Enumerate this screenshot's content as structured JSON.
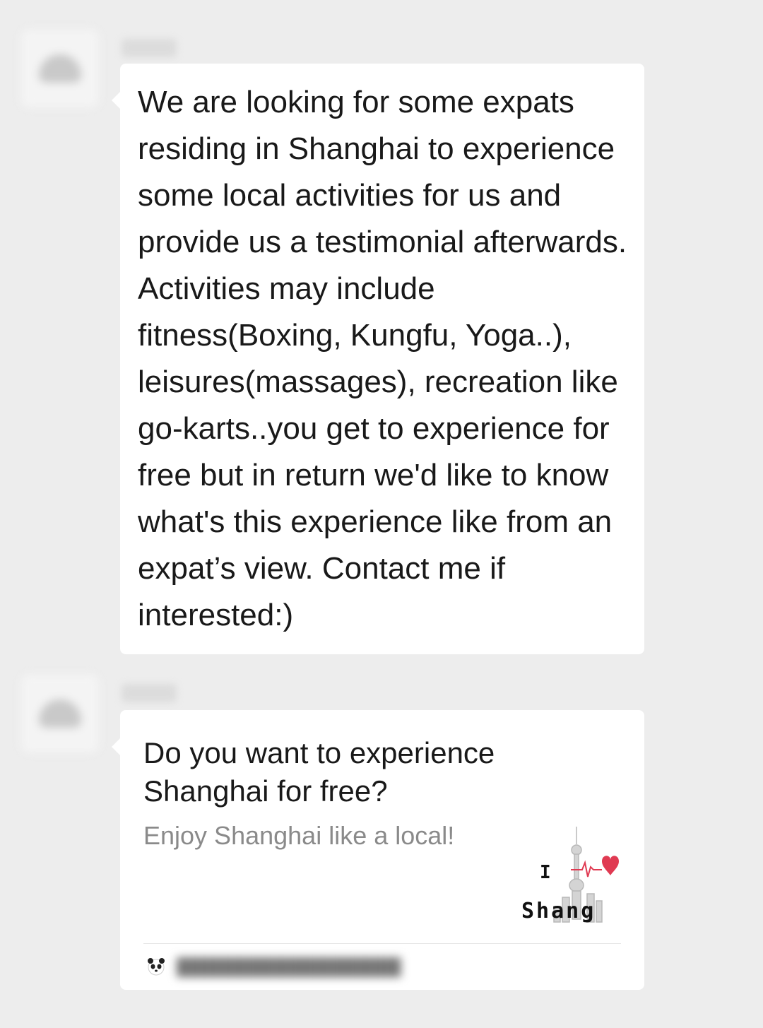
{
  "messages": [
    {
      "type": "text",
      "text": "We are looking for some expats residing in Shanghai to experience some local activities for us and provide us a testimonial afterwards. Activities may include fitness(Boxing, Kungfu, Yoga..), leisures(massages), recreation like go-karts..you get to experience for free but in return we'd like to know what's this experience like from an expat’s view. Contact me if interested:)"
    },
    {
      "type": "link-card",
      "title": "Do you want to experience Shanghai for free?",
      "description": "Enjoy Shanghai like a local!",
      "thumbnail": {
        "line1": "I",
        "line2": "Shang",
        "heart_color": "#e03a52"
      },
      "source_icon": "panda-icon"
    }
  ],
  "colors": {
    "background": "#ededed",
    "bubble": "#ffffff",
    "text": "#191919",
    "muted_text": "#8a8a8a"
  }
}
